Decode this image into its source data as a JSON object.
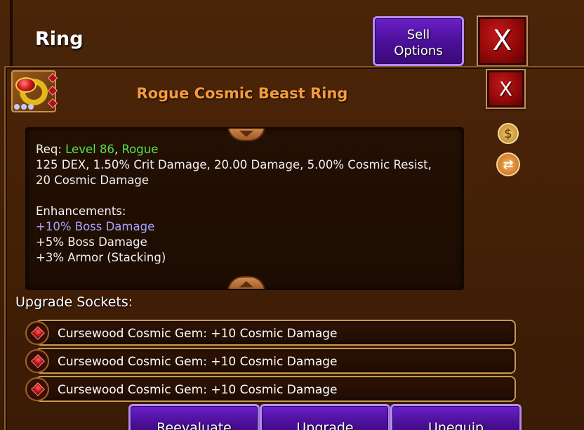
{
  "background_window": {
    "title": "Ring",
    "sell_options_label": "Sell\nOptions",
    "close_label": "X"
  },
  "dialog": {
    "item_title": "Rogue Cosmic Beast Ring",
    "close_label": "X",
    "description": {
      "req_prefix": "Req: ",
      "req_level": "Level 86",
      "req_separator": ", ",
      "req_class": "Rogue",
      "stats_line_1": "125 DEX, 1.50% Crit Damage, 20.00 Damage, 5.00% Cosmic Resist,",
      "stats_line_2": "20 Cosmic Damage",
      "enhancements_heading": "Enhancements:",
      "enhancements": [
        {
          "text": "+10% Boss Damage",
          "color": "#a9a4ff"
        },
        {
          "text": "+5% Boss Damage",
          "color": "#f2f2f2"
        },
        {
          "text": "+3% Armor (Stacking)",
          "color": "#f2f2f2"
        }
      ]
    },
    "upgrade_sockets_label": "Upgrade Sockets:",
    "sockets": [
      {
        "label": "Cursewood Cosmic Gem: +10 Cosmic Damage"
      },
      {
        "label": "Cursewood Cosmic Gem: +10 Cosmic Damage"
      },
      {
        "label": "Cursewood Cosmic Gem: +10 Cosmic Damage"
      }
    ],
    "buttons": {
      "reevaluate": "Reevaluate",
      "upgrade": "Upgrade",
      "unequip": "Unequip"
    }
  },
  "colors": {
    "title_orange": "#f49a3c",
    "requirement_green": "#58e24a",
    "enhancement_purple": "#a9a4ff",
    "button_purple": "#4a0f96",
    "close_red": "#8e0808"
  },
  "icons": {
    "item": "ring-icon",
    "side_top": "money-bag-icon",
    "side_bottom": "swap-icon",
    "socket": "red-gem-icon"
  }
}
